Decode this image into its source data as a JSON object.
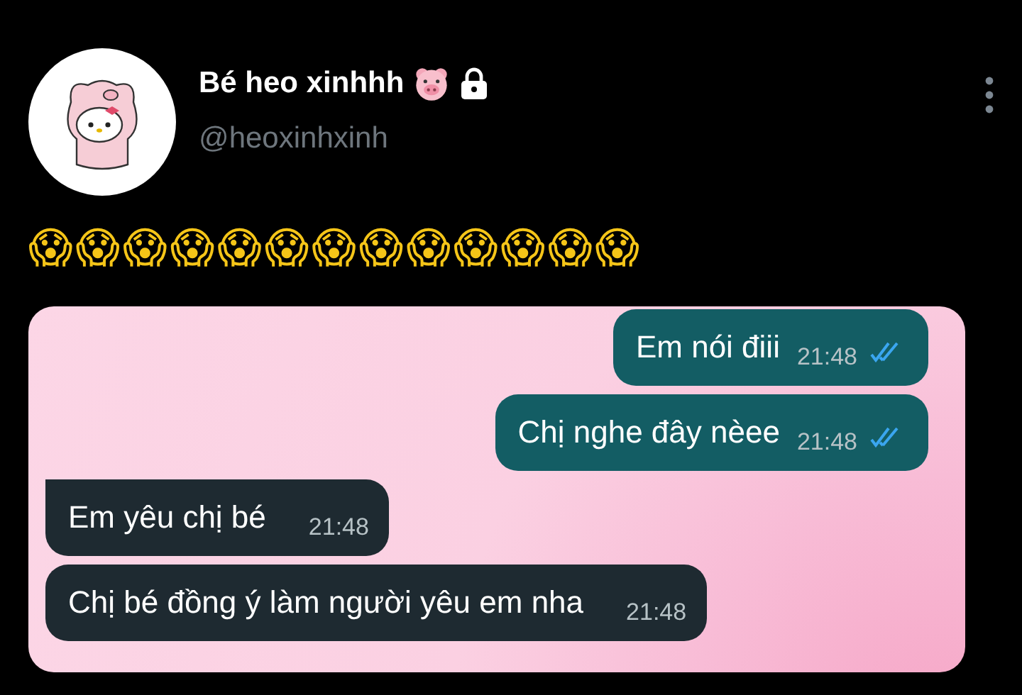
{
  "profile": {
    "name": "Bé heo xinhhh",
    "handle": "@heoxinhxinh",
    "locked": true
  },
  "tweet": {
    "text": "😱😱😱😱😱😱😱😱😱😱😱😱😱"
  },
  "chat": {
    "messages": [
      {
        "kind": "sent",
        "text": "Em nói điii",
        "time": "21:48",
        "read": true
      },
      {
        "kind": "sent",
        "text": "Chị nghe đây nèee",
        "time": "21:48",
        "read": true
      },
      {
        "kind": "received",
        "text": "Em yêu chị bé",
        "time": "21:48",
        "tail": true
      },
      {
        "kind": "received",
        "text": "Chị bé đồng ý làm người yêu em nha",
        "time": "21:48",
        "tail": false
      }
    ]
  }
}
